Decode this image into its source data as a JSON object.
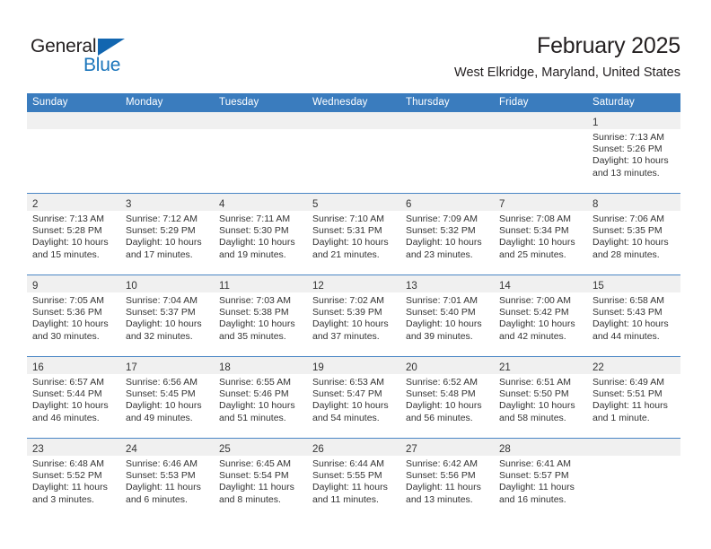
{
  "logo": {
    "word_top": "General",
    "word_bottom": "Blue",
    "triangle_color": "#1266b0",
    "blue_color": "#1a75bb"
  },
  "header": {
    "title": "February 2025",
    "subtitle": "West Elkridge, Maryland, United States"
  },
  "theme": {
    "header_bg": "#3a7cbe",
    "header_text": "#ffffff",
    "daynum_band": "#f0f0f0",
    "row_divider": "#4a86c5",
    "body_text": "#333333"
  },
  "calendar": {
    "weekday_headers": [
      "Sunday",
      "Monday",
      "Tuesday",
      "Wednesday",
      "Thursday",
      "Friday",
      "Saturday"
    ],
    "weeks": [
      [
        {
          "day": "",
          "lines": []
        },
        {
          "day": "",
          "lines": []
        },
        {
          "day": "",
          "lines": []
        },
        {
          "day": "",
          "lines": []
        },
        {
          "day": "",
          "lines": []
        },
        {
          "day": "",
          "lines": []
        },
        {
          "day": "1",
          "lines": [
            "Sunrise: 7:13 AM",
            "Sunset: 5:26 PM",
            "Daylight: 10 hours",
            "and 13 minutes."
          ]
        }
      ],
      [
        {
          "day": "2",
          "lines": [
            "Sunrise: 7:13 AM",
            "Sunset: 5:28 PM",
            "Daylight: 10 hours",
            "and 15 minutes."
          ]
        },
        {
          "day": "3",
          "lines": [
            "Sunrise: 7:12 AM",
            "Sunset: 5:29 PM",
            "Daylight: 10 hours",
            "and 17 minutes."
          ]
        },
        {
          "day": "4",
          "lines": [
            "Sunrise: 7:11 AM",
            "Sunset: 5:30 PM",
            "Daylight: 10 hours",
            "and 19 minutes."
          ]
        },
        {
          "day": "5",
          "lines": [
            "Sunrise: 7:10 AM",
            "Sunset: 5:31 PM",
            "Daylight: 10 hours",
            "and 21 minutes."
          ]
        },
        {
          "day": "6",
          "lines": [
            "Sunrise: 7:09 AM",
            "Sunset: 5:32 PM",
            "Daylight: 10 hours",
            "and 23 minutes."
          ]
        },
        {
          "day": "7",
          "lines": [
            "Sunrise: 7:08 AM",
            "Sunset: 5:34 PM",
            "Daylight: 10 hours",
            "and 25 minutes."
          ]
        },
        {
          "day": "8",
          "lines": [
            "Sunrise: 7:06 AM",
            "Sunset: 5:35 PM",
            "Daylight: 10 hours",
            "and 28 minutes."
          ]
        }
      ],
      [
        {
          "day": "9",
          "lines": [
            "Sunrise: 7:05 AM",
            "Sunset: 5:36 PM",
            "Daylight: 10 hours",
            "and 30 minutes."
          ]
        },
        {
          "day": "10",
          "lines": [
            "Sunrise: 7:04 AM",
            "Sunset: 5:37 PM",
            "Daylight: 10 hours",
            "and 32 minutes."
          ]
        },
        {
          "day": "11",
          "lines": [
            "Sunrise: 7:03 AM",
            "Sunset: 5:38 PM",
            "Daylight: 10 hours",
            "and 35 minutes."
          ]
        },
        {
          "day": "12",
          "lines": [
            "Sunrise: 7:02 AM",
            "Sunset: 5:39 PM",
            "Daylight: 10 hours",
            "and 37 minutes."
          ]
        },
        {
          "day": "13",
          "lines": [
            "Sunrise: 7:01 AM",
            "Sunset: 5:40 PM",
            "Daylight: 10 hours",
            "and 39 minutes."
          ]
        },
        {
          "day": "14",
          "lines": [
            "Sunrise: 7:00 AM",
            "Sunset: 5:42 PM",
            "Daylight: 10 hours",
            "and 42 minutes."
          ]
        },
        {
          "day": "15",
          "lines": [
            "Sunrise: 6:58 AM",
            "Sunset: 5:43 PM",
            "Daylight: 10 hours",
            "and 44 minutes."
          ]
        }
      ],
      [
        {
          "day": "16",
          "lines": [
            "Sunrise: 6:57 AM",
            "Sunset: 5:44 PM",
            "Daylight: 10 hours",
            "and 46 minutes."
          ]
        },
        {
          "day": "17",
          "lines": [
            "Sunrise: 6:56 AM",
            "Sunset: 5:45 PM",
            "Daylight: 10 hours",
            "and 49 minutes."
          ]
        },
        {
          "day": "18",
          "lines": [
            "Sunrise: 6:55 AM",
            "Sunset: 5:46 PM",
            "Daylight: 10 hours",
            "and 51 minutes."
          ]
        },
        {
          "day": "19",
          "lines": [
            "Sunrise: 6:53 AM",
            "Sunset: 5:47 PM",
            "Daylight: 10 hours",
            "and 54 minutes."
          ]
        },
        {
          "day": "20",
          "lines": [
            "Sunrise: 6:52 AM",
            "Sunset: 5:48 PM",
            "Daylight: 10 hours",
            "and 56 minutes."
          ]
        },
        {
          "day": "21",
          "lines": [
            "Sunrise: 6:51 AM",
            "Sunset: 5:50 PM",
            "Daylight: 10 hours",
            "and 58 minutes."
          ]
        },
        {
          "day": "22",
          "lines": [
            "Sunrise: 6:49 AM",
            "Sunset: 5:51 PM",
            "Daylight: 11 hours",
            "and 1 minute."
          ]
        }
      ],
      [
        {
          "day": "23",
          "lines": [
            "Sunrise: 6:48 AM",
            "Sunset: 5:52 PM",
            "Daylight: 11 hours",
            "and 3 minutes."
          ]
        },
        {
          "day": "24",
          "lines": [
            "Sunrise: 6:46 AM",
            "Sunset: 5:53 PM",
            "Daylight: 11 hours",
            "and 6 minutes."
          ]
        },
        {
          "day": "25",
          "lines": [
            "Sunrise: 6:45 AM",
            "Sunset: 5:54 PM",
            "Daylight: 11 hours",
            "and 8 minutes."
          ]
        },
        {
          "day": "26",
          "lines": [
            "Sunrise: 6:44 AM",
            "Sunset: 5:55 PM",
            "Daylight: 11 hours",
            "and 11 minutes."
          ]
        },
        {
          "day": "27",
          "lines": [
            "Sunrise: 6:42 AM",
            "Sunset: 5:56 PM",
            "Daylight: 11 hours",
            "and 13 minutes."
          ]
        },
        {
          "day": "28",
          "lines": [
            "Sunrise: 6:41 AM",
            "Sunset: 5:57 PM",
            "Daylight: 11 hours",
            "and 16 minutes."
          ]
        },
        {
          "day": "",
          "lines": []
        }
      ]
    ]
  }
}
